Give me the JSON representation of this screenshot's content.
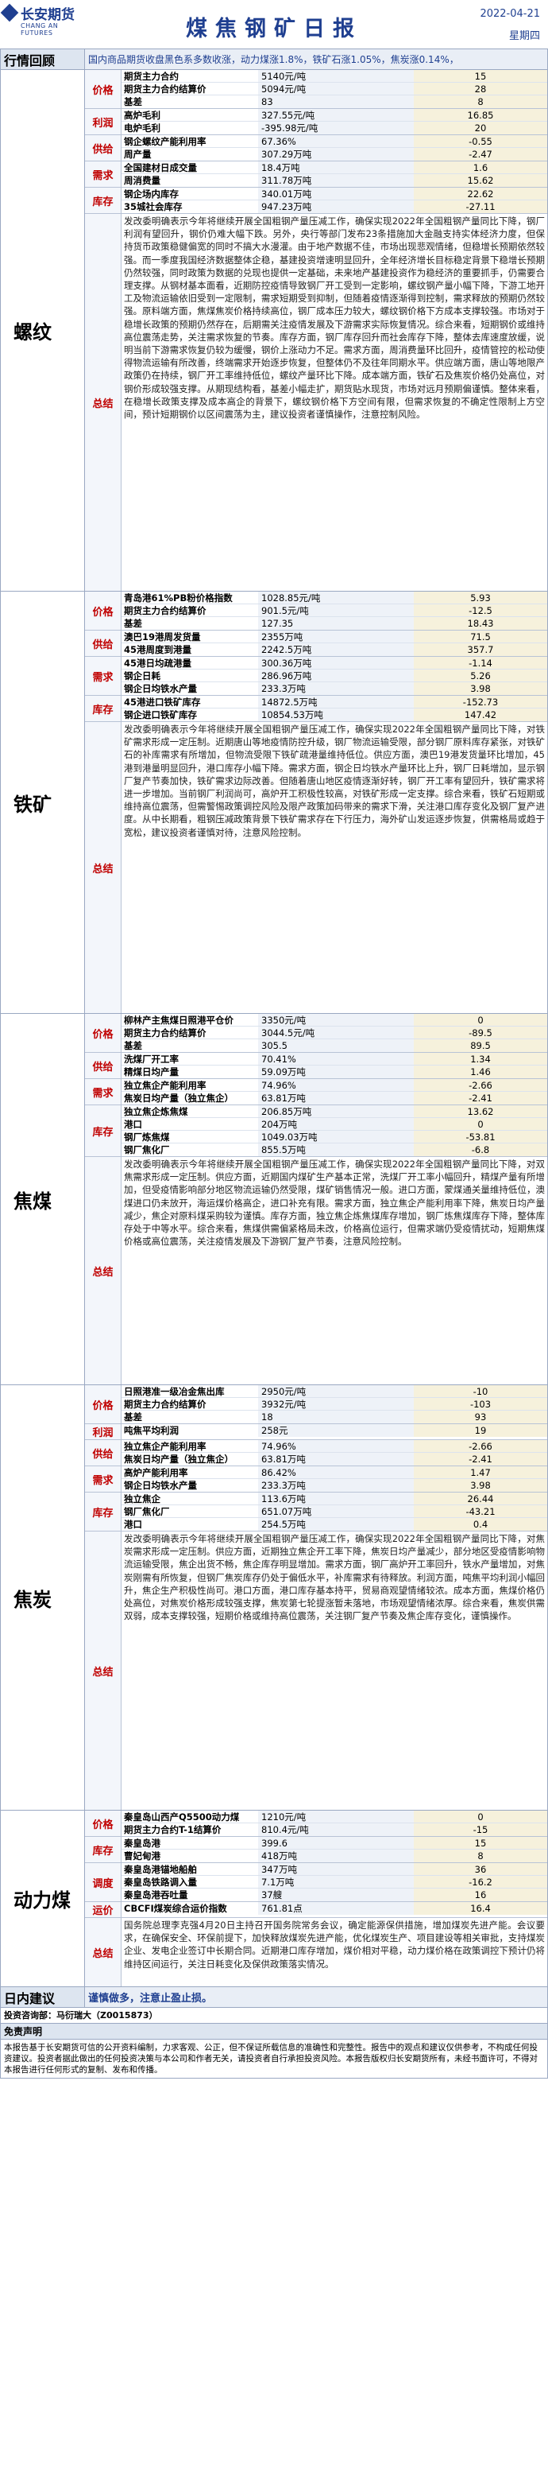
{
  "header": {
    "logo_cn": "长安期货",
    "logo_en": "CHANG AN FUTURES",
    "title": "煤焦钢矿日报",
    "date": "2022-04-21",
    "weekday": "星期四"
  },
  "recap": {
    "label": "行情回顾",
    "text": "国内商品期货收盘黑色系多数收涨，动力煤涨1.8%，铁矿石涨1.05%，焦炭涨0.14%，"
  },
  "sections": [
    {
      "name": "螺纹",
      "groups": [
        {
          "cat": "价格",
          "lines": [
            [
              "期货主力合约",
              "5140元/吨",
              "15"
            ],
            [
              "期货主力合约结算价",
              "5094元/吨",
              "28"
            ],
            [
              "基差",
              "83",
              "8"
            ]
          ]
        },
        {
          "cat": "利润",
          "lines": [
            [
              "高炉毛利",
              "327.55元/吨",
              "16.85"
            ],
            [
              "电炉毛利",
              "-395.98元/吨",
              "20"
            ]
          ]
        },
        {
          "cat": "供给",
          "lines": [
            [
              "钢企螺纹产能利用率",
              "67.36%",
              "-0.55"
            ],
            [
              "周产量",
              "307.29万吨",
              "-2.47"
            ]
          ]
        },
        {
          "cat": "需求",
          "lines": [
            [
              "全国建材日成交量",
              "18.4万吨",
              "1.6"
            ],
            [
              "周消费量",
              "311.78万吨",
              "15.62"
            ]
          ]
        },
        {
          "cat": "库存",
          "lines": [
            [
              "钢企场内库存",
              "340.01万吨",
              "22.62"
            ],
            [
              "35城社会库存",
              "947.23万吨",
              "-27.11"
            ]
          ]
        }
      ],
      "summary_height": 474,
      "summary": "发改委明确表示今年将继续开展全国粗钢产量压减工作，确保实现2022年全国粗钢产量同比下降，钢厂利润有望回升，钢价仍难大幅下跌。另外，央行等部门发布23条措施加大金融支持实体经济力度，但保持货币政策稳健偏宽的同时不搞大水漫灌。由于地产数据不佳，市场出现悲观情绪，但稳增长预期依然较强。而一季度我国经济数据整体企稳，基建投资增速明显回升，全年经济增长目标稳定背景下稳增长预期仍然较强，同时政策为数据的兑现也提供一定基础，未来地产基建投资作为稳经济的重要抓手，仍需要合理支撑。从钢材基本面看，近期防控疫情导致钢厂开工受到一定影响，螺纹钢产量小幅下降，下游工地开工及物流运输依旧受到一定限制，需求短期受到抑制，但随着疫情逐渐得到控制，需求释放的预期仍然较强。原料端方面，焦煤焦炭价格持续高位，钢厂成本压力较大，螺纹钢价格下方成本支撑较强。市场对于稳增长政策的预期仍然存在，后期需关注疫情发展及下游需求实际恢复情况。综合来看，短期钢价或维持高位震荡走势，关注需求恢复的节奏。库存方面，钢厂库存回升而社会库存下降，整体去库速度放缓，说明当前下游需求恢复仍较为缓慢，钢价上涨动力不足。需求方面，周消费量环比回升，疫情管控的松动使得物流运输有所改善，终端需求开始逐步恢复，但整体仍不及往年同期水平。供应端方面，唐山等地限产政策仍在持续，钢厂开工率维持低位，螺纹产量环比下降。成本端方面，铁矿石及焦炭价格仍处高位，对钢价形成较强支撑。从期现结构看，基差小幅走扩，期货贴水现货，市场对远月预期偏谨慎。整体来看，在稳增长政策支撑及成本高企的背景下，螺纹钢价格下方空间有限，但需求恢复的不确定性限制上方空间，预计短期钢价以区间震荡为主，建议投资者谨慎操作，注意控制风险。"
    },
    {
      "name": "铁矿",
      "groups": [
        {
          "cat": "价格",
          "lines": [
            [
              "青岛港61%PB粉价格指数",
              "1028.85元/吨",
              "5.93"
            ],
            [
              "期货主力合约结算价",
              "901.5元/吨",
              "-12.5"
            ],
            [
              "基差",
              "127.35",
              "18.43"
            ]
          ]
        },
        {
          "cat": "供给",
          "lines": [
            [
              "澳巴19港周发货量",
              "2355万吨",
              "71.5"
            ],
            [
              "45港周度到港量",
              "2242.5万吨",
              "357.7"
            ]
          ]
        },
        {
          "cat": "需求",
          "lines": [
            [
              "45港日均疏港量",
              "300.36万吨",
              "-1.14"
            ],
            [
              "钢企日耗",
              "286.96万吨",
              "5.26"
            ],
            [
              "钢企日均铁水产量",
              "233.3万吨",
              "3.98"
            ]
          ]
        },
        {
          "cat": "库存",
          "lines": [
            [
              "45港进口铁矿库存",
              "14872.5万吨",
              "-152.73"
            ],
            [
              "钢企进口铁矿库存",
              "10854.53万吨",
              "147.42"
            ]
          ]
        }
      ],
      "summary_height": 366,
      "summary": "发改委明确表示今年将继续开展全国粗钢产量压减工作，确保实现2022年全国粗钢产量同比下降，对铁矿需求形成一定压制。近期唐山等地疫情防控升级，钢厂物流运输受限，部分钢厂原料库存紧张，对铁矿石的补库需求有所增加，但物流受限下铁矿疏港量维持低位。供应方面，澳巴19港发货量环比增加，45港到港量明显回升，港口库存小幅下降。需求方面，钢企日均铁水产量环比上升，钢厂日耗增加，显示钢厂复产节奏加快，铁矿需求边际改善。但随着唐山地区疫情逐渐好转，钢厂开工率有望回升，铁矿需求将进一步增加。当前钢厂利润尚可，高炉开工积极性较高，对铁矿形成一定支撑。综合来看，铁矿石短期或维持高位震荡，但需警惕政策调控风险及限产政策加码带来的需求下滑，关注港口库存变化及钢厂复产进度。从中长期看，粗钢压减政策背景下铁矿需求存在下行压力，海外矿山发运逐步恢复，供需格局或趋于宽松，建议投资者谨慎对待，注意风险控制。"
    },
    {
      "name": "焦煤",
      "groups": [
        {
          "cat": "价格",
          "lines": [
            [
              "柳林产主焦煤日照港平仓价",
              "3350元/吨",
              "0"
            ],
            [
              "期货主力合约结算价",
              "3044.5元/吨",
              "-89.5"
            ],
            [
              "基差",
              "305.5",
              "89.5"
            ]
          ]
        },
        {
          "cat": "供给",
          "lines": [
            [
              "洗煤厂开工率",
              "70.41%",
              "1.34"
            ],
            [
              "精煤日均产量",
              "59.09万吨",
              "1.46"
            ]
          ]
        },
        {
          "cat": "需求",
          "lines": [
            [
              "独立焦企产能利用率",
              "74.96%",
              "-2.66"
            ],
            [
              "焦炭日均产量（独立焦企）",
              "63.81万吨",
              "-2.41"
            ]
          ]
        },
        {
          "cat": "库存",
          "lines": [
            [
              "独立焦企炼焦煤",
              "206.85万吨",
              "13.62"
            ],
            [
              "港口",
              "204万吨",
              "0"
            ],
            [
              "钢厂炼焦煤",
              "1049.03万吨",
              "-53.81"
            ],
            [
              "钢厂焦化厂",
              "855.5万吨",
              "-6.8"
            ]
          ]
        }
      ],
      "summary_height": 286,
      "summary": "发改委明确表示今年将继续开展全国粗钢产量压减工作，确保实现2022年全国粗钢产量同比下降，对双焦需求形成一定压制。供应方面，近期国内煤矿生产基本正常，洗煤厂开工率小幅回升，精煤产量有所增加，但受疫情影响部分地区物流运输仍然受限，煤矿销售情况一般。进口方面，蒙煤通关量维持低位，澳煤进口仍未放开，海运煤价格高企，进口补充有限。需求方面，独立焦企产能利用率下降，焦炭日均产量减少，焦企对原料煤采购较为谨慎。库存方面，独立焦企炼焦煤库存增加，钢厂炼焦煤库存下降，整体库存处于中等水平。综合来看，焦煤供需偏紧格局未改，价格高位运行，但需求端仍受疫情扰动，短期焦煤价格或高位震荡，关注疫情发展及下游钢厂复产节奏，注意风险控制。"
    },
    {
      "name": "焦炭",
      "groups": [
        {
          "cat": "价格",
          "lines": [
            [
              "日照港准一级冶金焦出库",
              "2950元/吨",
              "-10"
            ],
            [
              "期货主力合约结算价",
              "3932元/吨",
              "-103"
            ],
            [
              "基差",
              "18",
              "93"
            ]
          ]
        },
        {
          "cat": "利润",
          "lines": [
            [
              "吨焦平均利润",
              "258元",
              "19"
            ]
          ]
        },
        {
          "cat": "供给",
          "lines": [
            [
              "独立焦企产能利用率",
              "74.96%",
              "-2.66"
            ],
            [
              "焦炭日均产量（独立焦企）",
              "63.81万吨",
              "-2.41"
            ]
          ]
        },
        {
          "cat": "需求",
          "lines": [
            [
              "高炉产能利用率",
              "86.42%",
              "1.47"
            ],
            [
              "钢企日均铁水产量",
              "233.3万吨",
              "3.98"
            ]
          ]
        },
        {
          "cat": "库存",
          "lines": [
            [
              "独立焦企",
              "113.6万吨",
              "26.44"
            ],
            [
              "钢厂焦化厂",
              "651.07万吨",
              "-43.21"
            ],
            [
              "港口",
              "254.5万吨",
              "0.4"
            ]
          ]
        }
      ],
      "summary_height": 350,
      "summary": "发改委明确表示今年将继续开展全国粗钢产量压减工作，确保实现2022年全国粗钢产量同比下降，对焦炭需求形成一定压制。供应方面，近期独立焦企开工率下降，焦炭日均产量减少，部分地区受疫情影响物流运输受限，焦企出货不畅，焦企库存明显增加。需求方面，钢厂高炉开工率回升，铁水产量增加，对焦炭刚需有所恢复，但钢厂焦炭库存仍处于偏低水平，补库需求有待释放。利润方面，吨焦平均利润小幅回升，焦企生产积极性尚可。港口方面，港口库存基本持平，贸易商观望情绪较浓。成本方面，焦煤价格仍处高位，对焦炭价格形成较强支撑，焦炭第七轮提涨暂未落地，市场观望情绪浓厚。综合来看，焦炭供需双弱，成本支撑较强，短期价格或维持高位震荡，关注钢厂复产节奏及焦企库存变化，谨慎操作。"
    },
    {
      "name": "动力煤",
      "groups": [
        {
          "cat": "价格",
          "lines": [
            [
              "秦皇岛山西产Q5500动力煤",
              "1210元/吨",
              "0"
            ],
            [
              "期货主力合约T-1结算价",
              "810.4元/吨",
              "-15"
            ]
          ]
        },
        {
          "cat": "库存",
          "lines": [
            [
              "秦皇岛港",
              "399.6",
              "15"
            ],
            [
              "曹妃甸港",
              "418万吨",
              "8"
            ]
          ]
        },
        {
          "cat": "调度",
          "lines": [
            [
              "秦皇岛港锚地船舶",
              "347万吨",
              "36"
            ],
            [
              "秦皇岛铁路调入量",
              "7.1万吨",
              "-16.2"
            ],
            [
              "秦皇岛港吞吐量",
              "37艘",
              "16"
            ]
          ]
        },
        {
          "cat": "运价",
          "lines": [
            [
              "CBCFI煤炭综合运价指数",
              "761.81点",
              "16.4"
            ]
          ]
        }
      ],
      "summary_height": 86,
      "summary": "国务院总理李克强4月20日主持召开国务院常务会议，确定能源保供措施，增加煤炭先进产能。会议要求，在确保安全、环保前提下，加快释放煤炭先进产能，优化煤炭生产、项目建设等相关审批，支持煤炭企业、发电企业签订中长期合同。近期港口库存增加，煤价相对平稳，动力煤价格在政策调控下预计仍将维持区间运行，关注日耗变化及保供政策落实情况。"
    }
  ],
  "advice": {
    "label": "日内建议",
    "text": "谨慎做多，注意止盈止损。"
  },
  "author": "投资咨询部：马衍瑞大（Z0015873）",
  "disclaimer_title": "免责声明",
  "disclaimer": "本报告基于长安期货可信的公开资料编制，力求客观、公正，但不保证所载信息的准确性和完整性。报告中的观点和建议仅供参考，不构成任何投资建议。投资者据此做出的任何投资决策与本公司和作者无关，请投资者自行承担投资风险。本报告版权归长安期货所有，未经书面许可，不得对本报告进行任何形式的复制、发布和传播。"
}
